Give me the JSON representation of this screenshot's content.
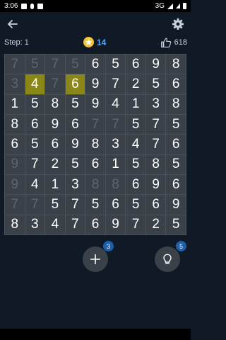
{
  "status_bar": {
    "time": "3:06",
    "network": "3G"
  },
  "info": {
    "step_label": "Step:",
    "step_value": "1",
    "coins": "14",
    "likes": "618"
  },
  "grid": [
    [
      "7",
      "5",
      "7",
      "5",
      "6",
      "5",
      "6",
      "9",
      "8"
    ],
    [
      "3",
      "4",
      "7",
      "6",
      "9",
      "7",
      "2",
      "5",
      "6"
    ],
    [
      "1",
      "5",
      "8",
      "5",
      "9",
      "4",
      "1",
      "3",
      "8"
    ],
    [
      "8",
      "6",
      "9",
      "6",
      "7",
      "7",
      "5",
      "7",
      "5"
    ],
    [
      "6",
      "5",
      "6",
      "9",
      "8",
      "3",
      "4",
      "7",
      "6"
    ],
    [
      "9",
      "7",
      "2",
      "5",
      "6",
      "1",
      "5",
      "8",
      "5"
    ],
    [
      "9",
      "4",
      "1",
      "3",
      "8",
      "8",
      "6",
      "9",
      "6"
    ],
    [
      "7",
      "7",
      "5",
      "7",
      "5",
      "6",
      "5",
      "6",
      "9"
    ],
    [
      "8",
      "3",
      "4",
      "7",
      "6",
      "9",
      "7",
      "2",
      "5"
    ]
  ],
  "grid_state": [
    [
      "dim",
      "dim",
      "dim",
      "dim",
      "",
      "",
      "",
      "",
      ""
    ],
    [
      "dim",
      "selected",
      "dim",
      "selected",
      "",
      "",
      "",
      "",
      ""
    ],
    [
      "",
      "",
      "",
      "",
      "",
      "",
      "",
      "",
      ""
    ],
    [
      "",
      "",
      "",
      "",
      "dim",
      "dim",
      "",
      "",
      ""
    ],
    [
      "",
      "",
      "",
      "",
      "",
      "",
      "",
      "",
      ""
    ],
    [
      "dim",
      "",
      "",
      "",
      "",
      "",
      "",
      "",
      ""
    ],
    [
      "dim",
      "",
      "",
      "",
      "dim",
      "dim",
      "",
      "",
      ""
    ],
    [
      "dim",
      "dim",
      "",
      "",
      "",
      "",
      "",
      "",
      ""
    ],
    [
      "",
      "",
      "",
      "",
      "",
      "",
      "",
      "",
      ""
    ]
  ],
  "buttons": {
    "add_badge": "3",
    "hint_badge": "5"
  },
  "colors": {
    "background": "#0f1a26",
    "cell": "#3a4148",
    "selected": "#8a8618",
    "accent": "#4da3ff",
    "badge": "#1e5fa8"
  },
  "icons": [
    "back-arrow-icon",
    "gear-icon",
    "star-coin-icon",
    "thumbs-up-icon",
    "plus-icon",
    "lightbulb-icon"
  ]
}
